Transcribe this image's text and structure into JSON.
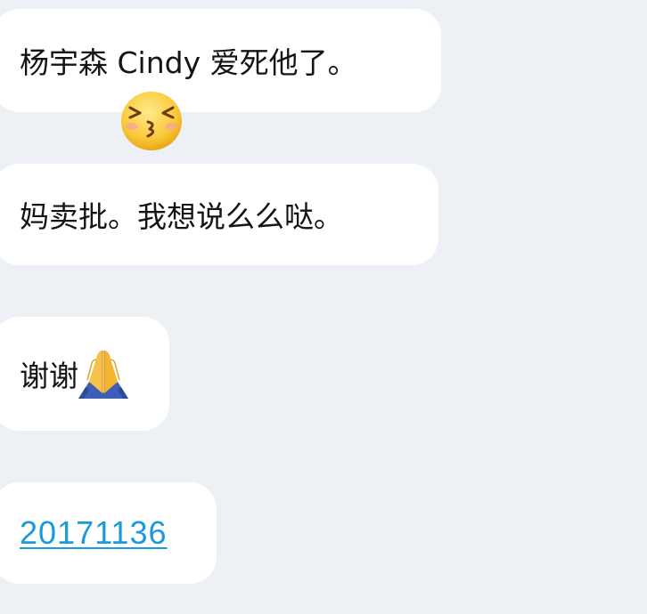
{
  "messages": [
    {
      "text": "杨宇森 Cindy 爱死他了。",
      "trailing_icon": null
    },
    {
      "text": "妈卖批。我想说么么哒。",
      "trailing_icon": null
    },
    {
      "text": "谢谢",
      "trailing_icon": "folded-hands-icon"
    },
    {
      "link_text": "20171136"
    }
  ],
  "reaction": {
    "icon": "kissing-face-icon"
  },
  "colors": {
    "background": "#edf1f6",
    "bubble": "#ffffff",
    "text": "#141414",
    "link": "#1a9ad8"
  }
}
